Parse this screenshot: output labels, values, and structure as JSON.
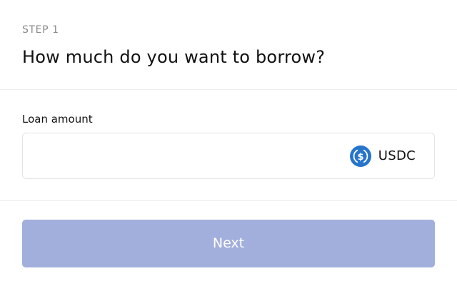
{
  "header": {
    "step_label": "STEP 1",
    "title": "How much do you want to borrow?"
  },
  "loan": {
    "field_label": "Loan amount",
    "amount_value": "",
    "token": {
      "name": "USDC",
      "icon": "usdc-coin-icon",
      "icon_color": "#2775ca"
    }
  },
  "actions": {
    "next_label": "Next",
    "next_disabled_color": "#a2aedb"
  }
}
